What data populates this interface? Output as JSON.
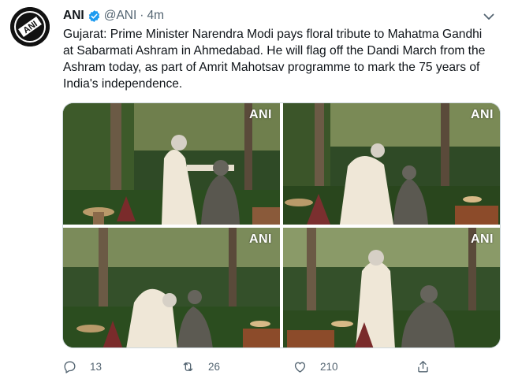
{
  "tweet": {
    "display_name": "ANI",
    "handle": "@ANI",
    "separator": "·",
    "time": "4m",
    "text": "Gujarat: Prime Minister Narendra Modi pays floral tribute to Mahatma Gandhi at Sabarmati Ashram in Ahmedabad. He will flag off the Dandi March from the Ashram today, as part of Amrit Mahotsav programme to mark the 75 years of India's independence.",
    "avatar_logo_text": "ANI",
    "photos": [
      {
        "watermark": "ANI"
      },
      {
        "watermark": "ANI"
      },
      {
        "watermark": "ANI"
      },
      {
        "watermark": "ANI"
      }
    ],
    "actions": {
      "reply_count": "13",
      "retweet_count": "26",
      "like_count": "210"
    }
  },
  "colors": {
    "text_primary": "#0f1419",
    "text_secondary": "#536471",
    "verified_blue": "#1d9bf0",
    "border": "#cfd9de"
  },
  "icons": [
    "verified-icon",
    "chevron-down-icon",
    "reply-icon",
    "retweet-icon",
    "like-icon",
    "share-icon"
  ]
}
